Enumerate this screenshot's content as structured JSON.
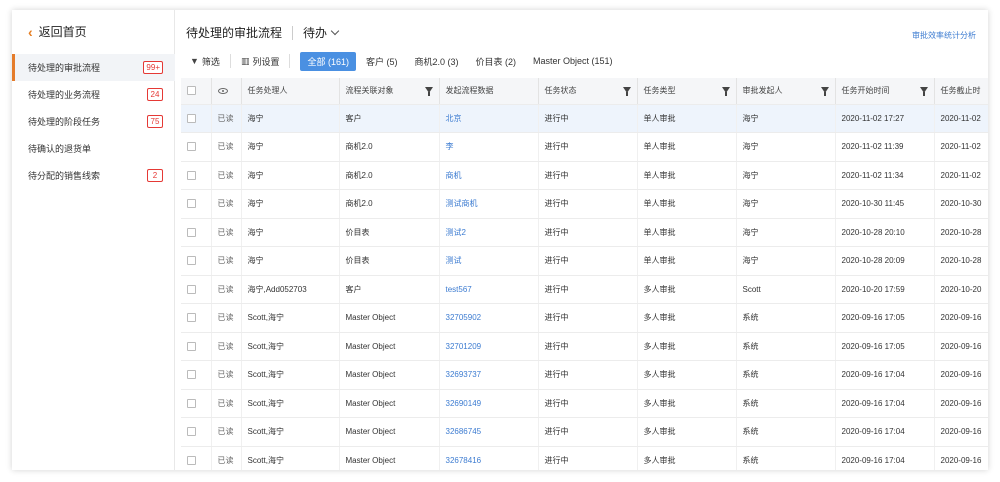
{
  "sidebar": {
    "back_label": "返回首页",
    "items": [
      {
        "label": "待处理的审批流程",
        "badge": "99+",
        "active": true
      },
      {
        "label": "待处理的业务流程",
        "badge": "24",
        "active": false
      },
      {
        "label": "待处理的阶段任务",
        "badge": "75",
        "active": false
      },
      {
        "label": "待确认的退货单",
        "badge": "",
        "active": false
      },
      {
        "label": "待分配的销售线索",
        "badge": "2",
        "active": false
      }
    ]
  },
  "header": {
    "title": "待处理的审批流程",
    "filter_select": "待办",
    "right_link": "审批效率统计分析"
  },
  "toolbar": {
    "filter_label": "筛选",
    "columns_label": "列设置",
    "tabs": [
      {
        "label": "全部 (161)",
        "active": true
      },
      {
        "label": "客户 (5)",
        "active": false
      },
      {
        "label": "商机2.0 (3)",
        "active": false
      },
      {
        "label": "价目表 (2)",
        "active": false
      },
      {
        "label": "Master Object (151)",
        "active": false
      }
    ]
  },
  "table": {
    "headers": [
      "",
      "",
      "任务处理人",
      "流程关联对象",
      "发起流程数据",
      "任务状态",
      "任务类型",
      "审批发起人",
      "任务开始时间",
      "任务截止时"
    ],
    "rows": [
      {
        "status": "已读",
        "handler": "海宁",
        "object": "客户",
        "data": "北京",
        "state": "进行中",
        "type": "单人审批",
        "initiator": "海宁",
        "start": "2020-11-02 17:27",
        "end": "2020-11-02"
      },
      {
        "status": "已读",
        "handler": "海宁",
        "object": "商机2.0",
        "data": "李",
        "state": "进行中",
        "type": "单人审批",
        "initiator": "海宁",
        "start": "2020-11-02 11:39",
        "end": "2020-11-02"
      },
      {
        "status": "已读",
        "handler": "海宁",
        "object": "商机2.0",
        "data": "商机",
        "state": "进行中",
        "type": "单人审批",
        "initiator": "海宁",
        "start": "2020-11-02 11:34",
        "end": "2020-11-02"
      },
      {
        "status": "已读",
        "handler": "海宁",
        "object": "商机2.0",
        "data": "测试商机",
        "state": "进行中",
        "type": "单人审批",
        "initiator": "海宁",
        "start": "2020-10-30 11:45",
        "end": "2020-10-30"
      },
      {
        "status": "已读",
        "handler": "海宁",
        "object": "价目表",
        "data": "测试2",
        "state": "进行中",
        "type": "单人审批",
        "initiator": "海宁",
        "start": "2020-10-28 20:10",
        "end": "2020-10-28"
      },
      {
        "status": "已读",
        "handler": "海宁",
        "object": "价目表",
        "data": "测试",
        "state": "进行中",
        "type": "单人审批",
        "initiator": "海宁",
        "start": "2020-10-28 20:09",
        "end": "2020-10-28"
      },
      {
        "status": "已读",
        "handler": "海宁,Add052703",
        "object": "客户",
        "data": "test567",
        "state": "进行中",
        "type": "多人审批",
        "initiator": "Scott",
        "start": "2020-10-20 17:59",
        "end": "2020-10-20"
      },
      {
        "status": "已读",
        "handler": "Scott,海宁",
        "object": "Master Object",
        "data": "32705902",
        "state": "进行中",
        "type": "多人审批",
        "initiator": "系统",
        "start": "2020-09-16 17:05",
        "end": "2020-09-16"
      },
      {
        "status": "已读",
        "handler": "Scott,海宁",
        "object": "Master Object",
        "data": "32701209",
        "state": "进行中",
        "type": "多人审批",
        "initiator": "系统",
        "start": "2020-09-16 17:05",
        "end": "2020-09-16"
      },
      {
        "status": "已读",
        "handler": "Scott,海宁",
        "object": "Master Object",
        "data": "32693737",
        "state": "进行中",
        "type": "多人审批",
        "initiator": "系统",
        "start": "2020-09-16 17:04",
        "end": "2020-09-16"
      },
      {
        "status": "已读",
        "handler": "Scott,海宁",
        "object": "Master Object",
        "data": "32690149",
        "state": "进行中",
        "type": "多人审批",
        "initiator": "系统",
        "start": "2020-09-16 17:04",
        "end": "2020-09-16"
      },
      {
        "status": "已读",
        "handler": "Scott,海宁",
        "object": "Master Object",
        "data": "32686745",
        "state": "进行中",
        "type": "多人审批",
        "initiator": "系统",
        "start": "2020-09-16 17:04",
        "end": "2020-09-16"
      },
      {
        "status": "已读",
        "handler": "Scott,海宁",
        "object": "Master Object",
        "data": "32678416",
        "state": "进行中",
        "type": "多人审批",
        "initiator": "系统",
        "start": "2020-09-16 17:04",
        "end": "2020-09-16"
      }
    ],
    "highlight_row": 0
  },
  "colors": {
    "accent": "#e57c2b",
    "tab_active": "#4a90e2",
    "link": "#3d7cd1",
    "badge": "#e53935",
    "row_highlight": "#eef4fc"
  }
}
